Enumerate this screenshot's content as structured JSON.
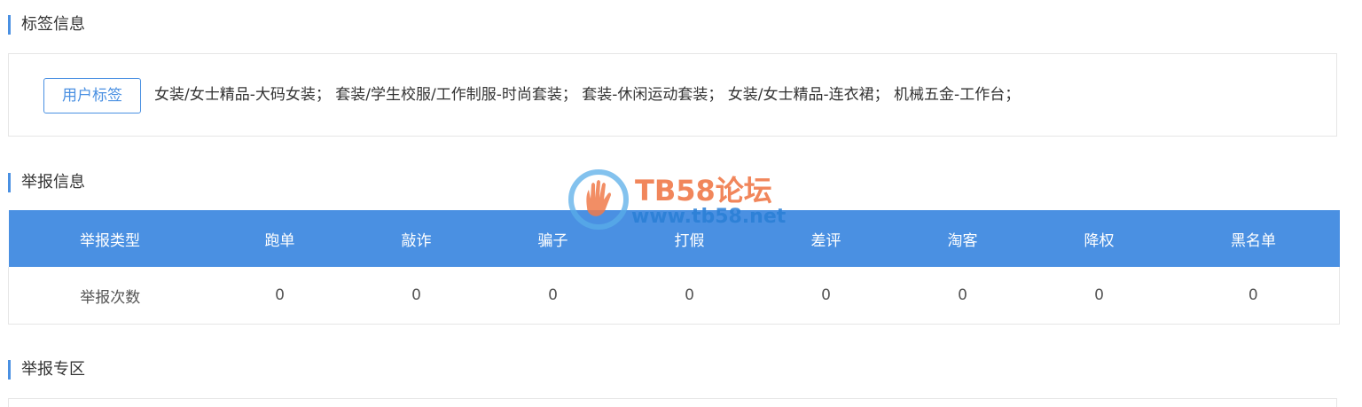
{
  "sections": {
    "tags_title": "标签信息",
    "report_title": "举报信息",
    "zone_title": "举报专区"
  },
  "tags": {
    "button_label": "用户标签",
    "text": "女装/女士精品-大码女装； 套装/学生校服/工作制服-时尚套装； 套装-休闲运动套装； 女装/女士精品-连衣裙； 机械五金-工作台；"
  },
  "report_table": {
    "headers": [
      "举报类型",
      "跑单",
      "敲诈",
      "骗子",
      "打假",
      "差评",
      "淘客",
      "降权",
      "黑名单"
    ],
    "row": [
      "举报次数",
      "0",
      "0",
      "0",
      "0",
      "0",
      "0",
      "0",
      "0"
    ]
  },
  "watermark": {
    "title": "TB58论坛",
    "url": "www.tb58.net"
  },
  "colors": {
    "accent": "#4a90e2",
    "watermark_orange": "#f07a4a",
    "watermark_blue": "#2a7fd6"
  }
}
